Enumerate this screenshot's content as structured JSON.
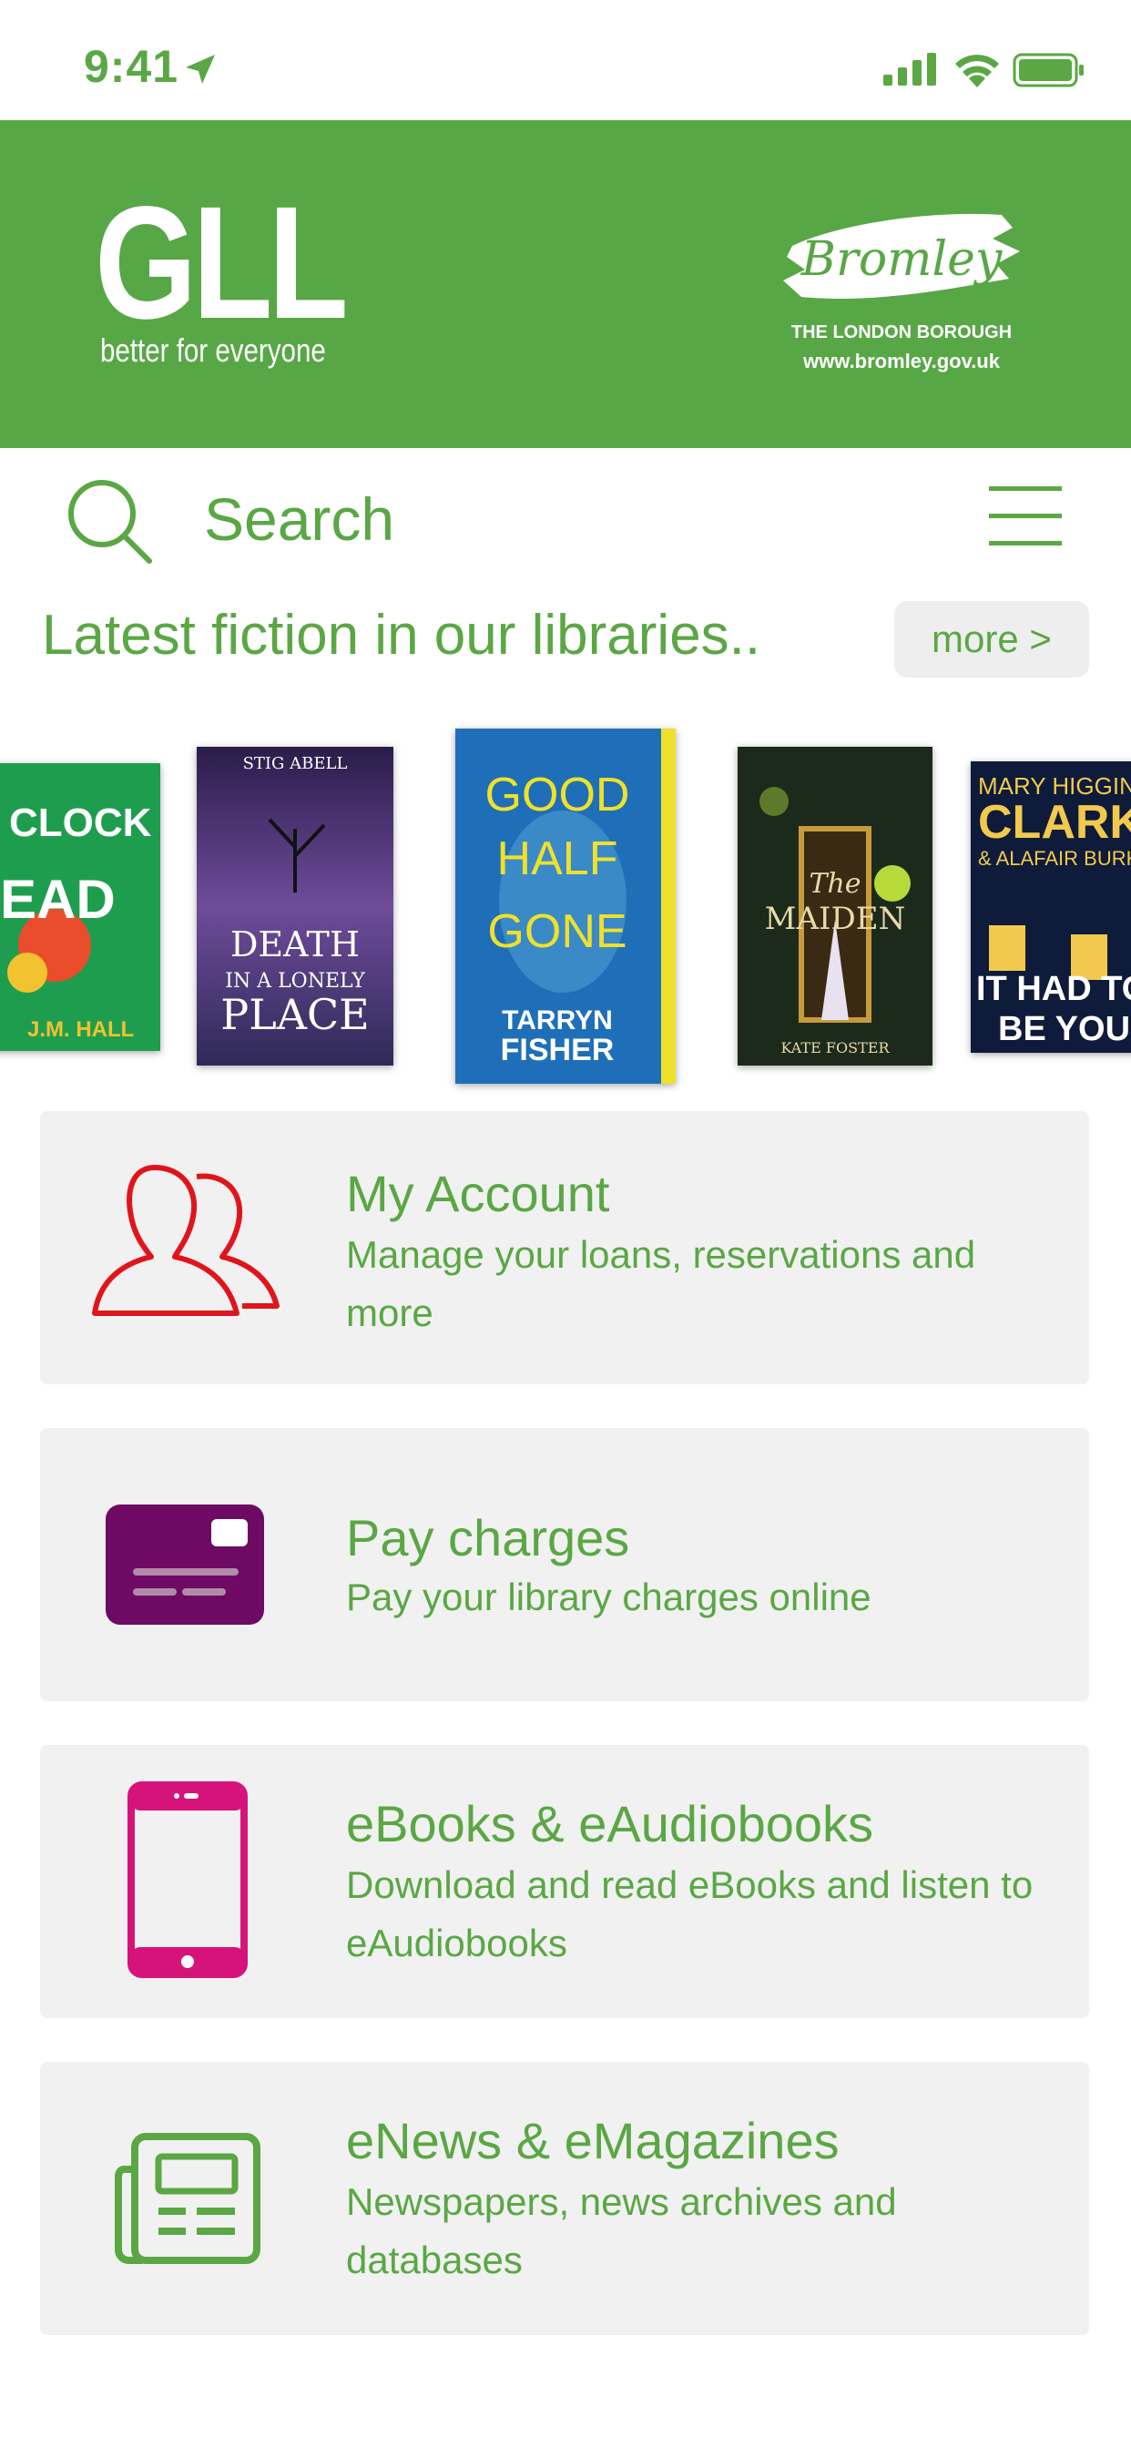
{
  "status": {
    "time": "9:41"
  },
  "header": {
    "gll_logo": "GLL",
    "gll_tagline": "better for everyone",
    "bromley_logo": "Bromley",
    "bromley_sub1": "THE LONDON BOROUGH",
    "bromley_sub2": "www.bromley.gov.uk",
    "background": "#58a746"
  },
  "search": {
    "placeholder": "Search"
  },
  "section": {
    "title": "Latest fiction in our libraries..",
    "more_label": "more >"
  },
  "books": [
    {
      "title": "A Clock Stopped Dead",
      "author": "J.M. HALL"
    },
    {
      "title": "DEATH IN A LONELY PLACE",
      "author": "STIG ABELL"
    },
    {
      "title": "GOOD HALF GONE",
      "author": "TARRYN FISHER"
    },
    {
      "title": "The MAIDEN",
      "author": "KATE FOSTER"
    },
    {
      "title": "IT HAD TO BE YOU",
      "author": "MARY HIGGINS CLARK & ALAFAIR BURKE"
    }
  ],
  "cards": [
    {
      "title": "My Account",
      "desc": "Manage your loans, reservations and more",
      "icon": "user-group-icon",
      "color": "#e0151b"
    },
    {
      "title": "Pay charges",
      "desc": "Pay your library charges online",
      "icon": "card-icon",
      "color": "#6e0a63"
    },
    {
      "title": "eBooks & eAudiobooks",
      "desc": "Download and read eBooks and listen to eAudiobooks",
      "icon": "phone-icon",
      "color": "#d6137a"
    },
    {
      "title": "eNews & eMagazines",
      "desc": "Newspapers, news archives and databases",
      "icon": "newspaper-icon",
      "color": "#5aa744"
    }
  ],
  "accent": "#5aa744"
}
